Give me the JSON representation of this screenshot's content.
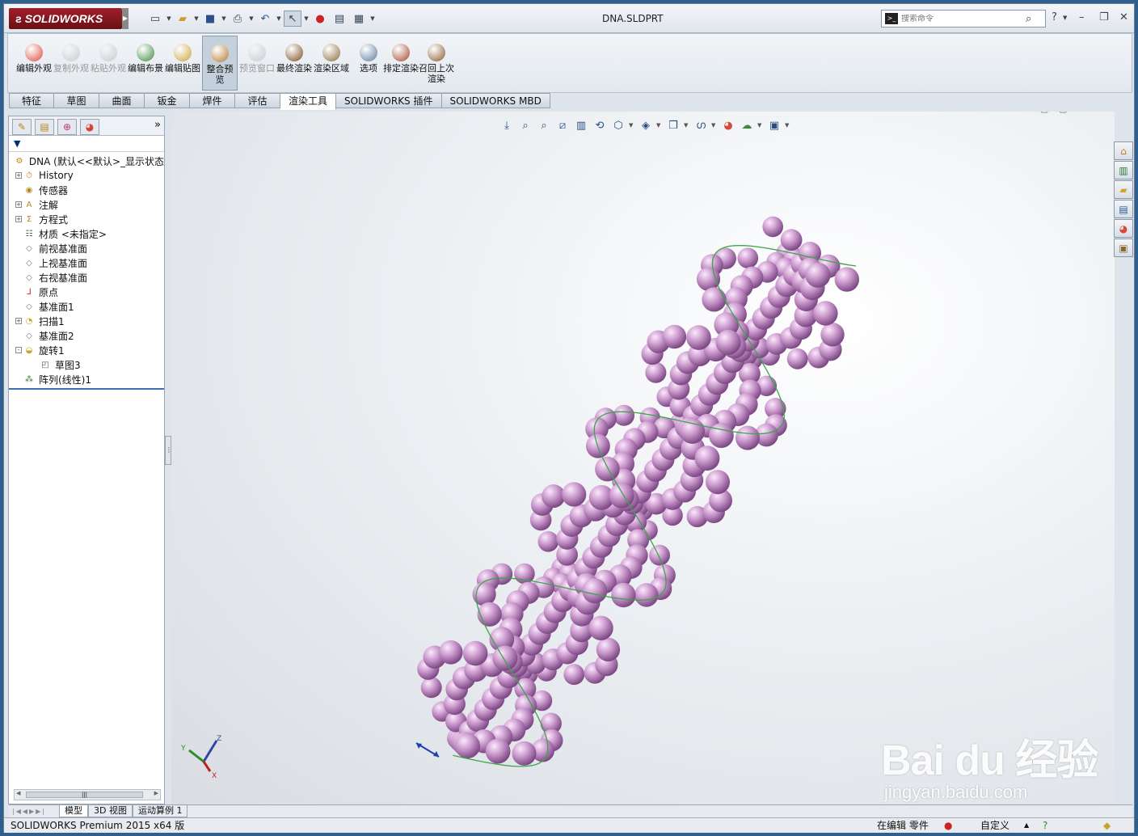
{
  "app": {
    "brand": "SOLIDWORKS",
    "document_title": "DNA.SLDPRT"
  },
  "search": {
    "placeholder": "搜索命令"
  },
  "ribbon": [
    {
      "id": "edit-appearance",
      "label": "编辑外观",
      "enabled": true,
      "color": "#d94a3a"
    },
    {
      "id": "copy-appearance",
      "label": "复制外观",
      "enabled": false,
      "color": "#8a8a8a"
    },
    {
      "id": "paste-appearance",
      "label": "粘贴外观",
      "enabled": false,
      "color": "#8a8a8a"
    },
    {
      "id": "edit-scene",
      "label": "编辑布景",
      "enabled": true,
      "color": "#3f8a3f"
    },
    {
      "id": "edit-decal",
      "label": "编辑贴图",
      "enabled": true,
      "color": "#c9a33a"
    },
    {
      "id": "integrated-preview",
      "label": "整合预览",
      "enabled": true,
      "selected": true,
      "color": "#b5772e"
    },
    {
      "id": "preview-window",
      "label": "预览窗口",
      "enabled": false,
      "color": "#8a8a8a"
    },
    {
      "id": "final-render",
      "label": "最终渲染",
      "enabled": true,
      "color": "#7a4b1e"
    },
    {
      "id": "render-region",
      "label": "渲染区域",
      "enabled": true,
      "color": "#8a6a3a"
    },
    {
      "id": "options",
      "label": "选项",
      "enabled": true,
      "color": "#5b7a9a"
    },
    {
      "id": "schedule-render",
      "label": "排定渲染",
      "enabled": true,
      "color": "#a3452e"
    },
    {
      "id": "recall-last-render",
      "label": "召回上次渲染",
      "enabled": true,
      "color": "#8a5a2e"
    }
  ],
  "tabs": [
    "特征",
    "草图",
    "曲面",
    "钣金",
    "焊件",
    "评估",
    "渲染工具",
    "SOLIDWORKS 插件",
    "SOLIDWORKS MBD"
  ],
  "active_tab": "渲染工具",
  "tree": [
    {
      "label": "DNA  (默认<<默认>_显示状态",
      "icon": "part-icon",
      "expand": "",
      "indent": 0
    },
    {
      "label": "History",
      "icon": "history-icon",
      "expand": "+",
      "indent": 1
    },
    {
      "label": "传感器",
      "icon": "sensor-icon",
      "expand": "",
      "indent": 1
    },
    {
      "label": "注解",
      "icon": "annotation-icon",
      "expand": "+",
      "indent": 1
    },
    {
      "label": "方程式",
      "icon": "equation-icon",
      "expand": "+",
      "indent": 1
    },
    {
      "label": "材质 <未指定>",
      "icon": "material-icon",
      "expand": "",
      "indent": 1
    },
    {
      "label": "前视基准面",
      "icon": "plane-icon",
      "expand": "",
      "indent": 1
    },
    {
      "label": "上视基准面",
      "icon": "plane-icon",
      "expand": "",
      "indent": 1
    },
    {
      "label": "右视基准面",
      "icon": "plane-icon",
      "expand": "",
      "indent": 1
    },
    {
      "label": "原点",
      "icon": "origin-icon",
      "expand": "",
      "indent": 1
    },
    {
      "label": "基准面1",
      "icon": "plane-icon",
      "expand": "",
      "indent": 1
    },
    {
      "label": "扫描1",
      "icon": "sweep-icon",
      "expand": "+",
      "indent": 1
    },
    {
      "label": "基准面2",
      "icon": "plane-icon",
      "expand": "",
      "indent": 1
    },
    {
      "label": "旋转1",
      "icon": "revolve-icon",
      "expand": "-",
      "indent": 1
    },
    {
      "label": "草图3",
      "icon": "sketch-icon",
      "expand": "",
      "indent": 2
    },
    {
      "label": "阵列(线性)1",
      "icon": "linear-pattern-icon",
      "expand": "",
      "indent": 1
    }
  ],
  "bottom_tabs": [
    "模型",
    "3D 视图",
    "运动算例 1"
  ],
  "active_bottom_tab": "模型",
  "status": {
    "product": "SOLIDWORKS Premium 2015 x64 版",
    "editing": "在编辑 零件",
    "custom": "自定义"
  },
  "triad": {
    "x": "X",
    "y": "Y",
    "z": "Z"
  },
  "watermark": {
    "line1": "Bai du 经验",
    "line2": "jingyan.baidu.com"
  },
  "colors": {
    "bead": "#c99acb",
    "helix": "#3aa54a"
  }
}
